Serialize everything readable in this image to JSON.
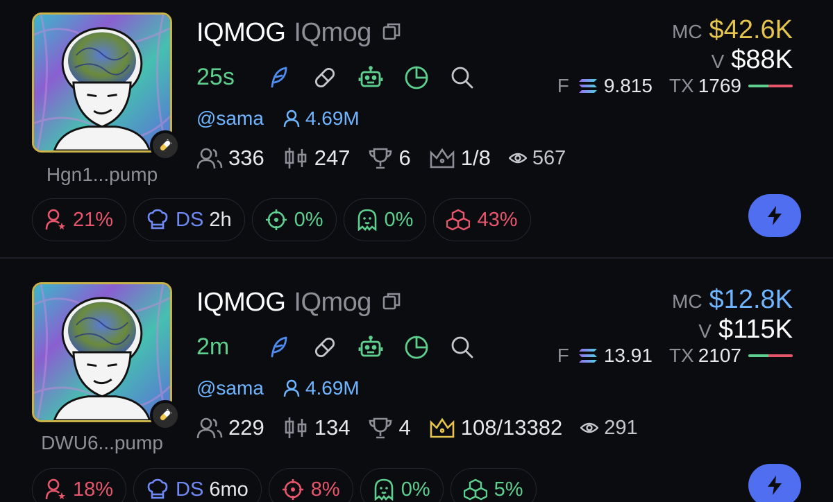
{
  "colors": {
    "background": "#0b0c10",
    "green": "#5ecf8e",
    "blue": "#6fb5ff",
    "red": "#e8566c",
    "gold": "#e6c54e",
    "gray": "#8e8f96",
    "bolt": "#4f6ef0"
  },
  "tokens": [
    {
      "address": "Hgn1...pump",
      "ticker": "IQMOG",
      "name": "IQmog",
      "age": "25s",
      "twitter": "@sama",
      "followers": "4.69M",
      "holders": "336",
      "pro_traders": "247",
      "top10": "6",
      "dev_rank": "1/8",
      "views": "567",
      "mc_label": "MC",
      "mc_value": "$42.6K",
      "mc_color": "#e6c54e",
      "v_label": "V",
      "volume": "$88K",
      "f_label": "F",
      "fees": "9.815",
      "tx_label": "TX",
      "tx": "1769",
      "tx_buy_ratio": 0.45,
      "chips": {
        "dev_holding": "21%",
        "ds_label": "DS",
        "ds_time": "2h",
        "snipers": "0%",
        "insiders": "0%",
        "bundles": "43%"
      },
      "chip_colors": {
        "dev_holding": "#e8566c",
        "snipers": "#5ecf8e",
        "insiders": "#5ecf8e",
        "bundles": "#e8566c"
      }
    },
    {
      "address": "DWU6...pump",
      "ticker": "IQMOG",
      "name": "IQmog",
      "age": "2m",
      "twitter": "@sama",
      "followers": "4.69M",
      "holders": "229",
      "pro_traders": "134",
      "top10": "4",
      "dev_rank": "108/13382",
      "views": "291",
      "mc_label": "MC",
      "mc_value": "$12.8K",
      "mc_color": "#6fb5ff",
      "v_label": "V",
      "volume": "$115K",
      "f_label": "F",
      "fees": "13.91",
      "tx_label": "TX",
      "tx": "2107",
      "tx_buy_ratio": 0.45,
      "chips": {
        "dev_holding": "18%",
        "ds_label": "DS",
        "ds_time": "6mo",
        "snipers": "8%",
        "insiders": "0%",
        "bundles": "5%"
      },
      "chip_colors": {
        "dev_holding": "#e8566c",
        "snipers": "#e8566c",
        "insiders": "#5ecf8e",
        "bundles": "#5ecf8e"
      }
    }
  ],
  "icons": {
    "copy": "copy-icon",
    "feather": "feather-icon",
    "pill": "pill-icon",
    "bot": "bot-icon",
    "pie": "pie-chart-icon",
    "search": "search-icon",
    "user": "user-icon",
    "users": "users-icon",
    "candles": "candles-icon",
    "trophy": "trophy-icon",
    "crown": "crown-icon",
    "eye": "eye-icon",
    "user_star": "user-star-icon",
    "chef": "chef-hat-icon",
    "crosshair": "crosshair-icon",
    "ghost": "ghost-icon",
    "cubes": "cubes-icon",
    "bolt": "lightning-bolt-icon",
    "solana": "solana-icon"
  }
}
